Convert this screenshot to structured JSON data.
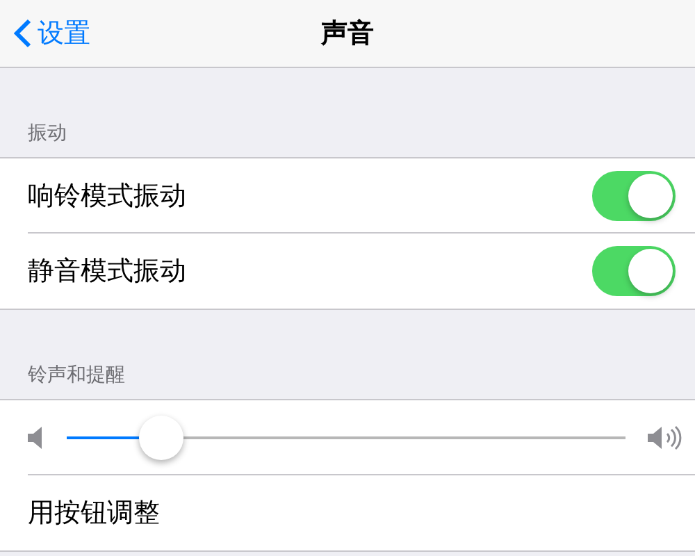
{
  "nav": {
    "back": "设置",
    "title": "声音"
  },
  "sections": [
    {
      "header": "振动",
      "rows": [
        {
          "kind": "switch",
          "label": "响铃模式振动",
          "on": true
        },
        {
          "kind": "switch",
          "label": "静音模式振动",
          "on": true
        }
      ]
    },
    {
      "header": "铃声和提醒",
      "rows": [
        {
          "kind": "slider",
          "level": 0.17
        },
        {
          "kind": "text",
          "label": "用按钮调整"
        }
      ]
    }
  ]
}
